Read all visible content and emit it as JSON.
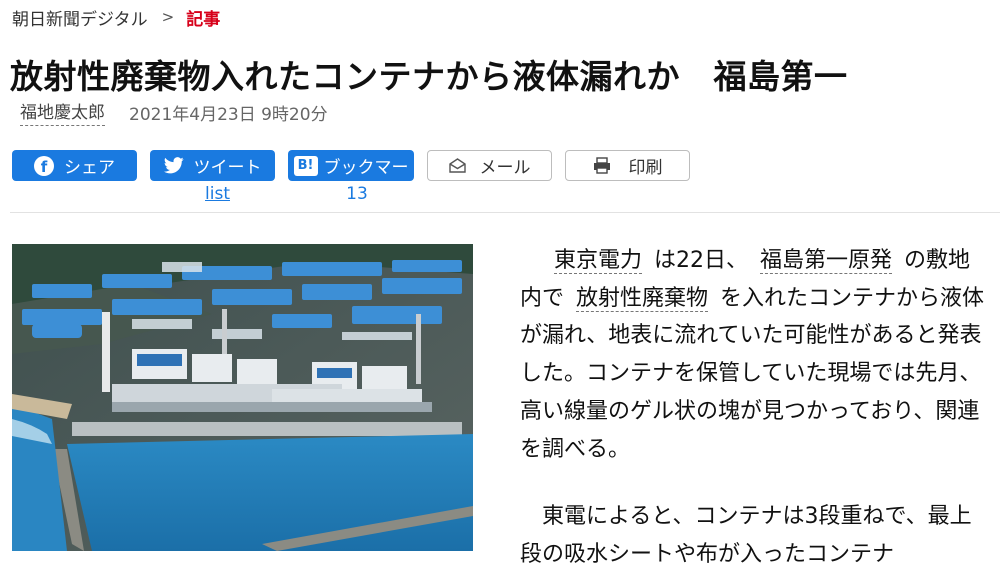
{
  "breadcrumb": {
    "site": "朝日新聞デジタル",
    "separator": ">",
    "current": "記事"
  },
  "article": {
    "headline": "放射性廃棄物入れたコンテナから液体漏れか　福島第一",
    "author": "福地慶太郎",
    "date": "2021年4月23日 9時20分"
  },
  "share": {
    "facebook_label": "シェア",
    "facebook_icon_glyph": "f",
    "twitter_label": "ツイート",
    "twitter_count": "list",
    "hatena_label": "ブックマー",
    "hatena_icon_glyph": "B!",
    "hatena_count": "13",
    "mail_label": "メール",
    "print_label": "印刷",
    "brand_color": "#1a7ae0"
  },
  "photo": {
    "icon": "aerial-photo-fukushima-plant"
  },
  "body": {
    "p1": {
      "link1": "東京電力",
      "t1": "は22日、",
      "link2": "福島第一原発",
      "t2": "の敷地内で",
      "link3": "放射性廃棄物",
      "t3": "を入れたコンテナから液体が漏れ、地表に流れていた可能性があると発表した。コンテナを保管していた現場では先月、高い線量のゲル状の塊が見つかっており、関連を調べる。"
    },
    "p2": {
      "text": "東電によると、コンテナは3段重ねで、最上段の吸水シートや布が入ったコンテナ"
    }
  }
}
